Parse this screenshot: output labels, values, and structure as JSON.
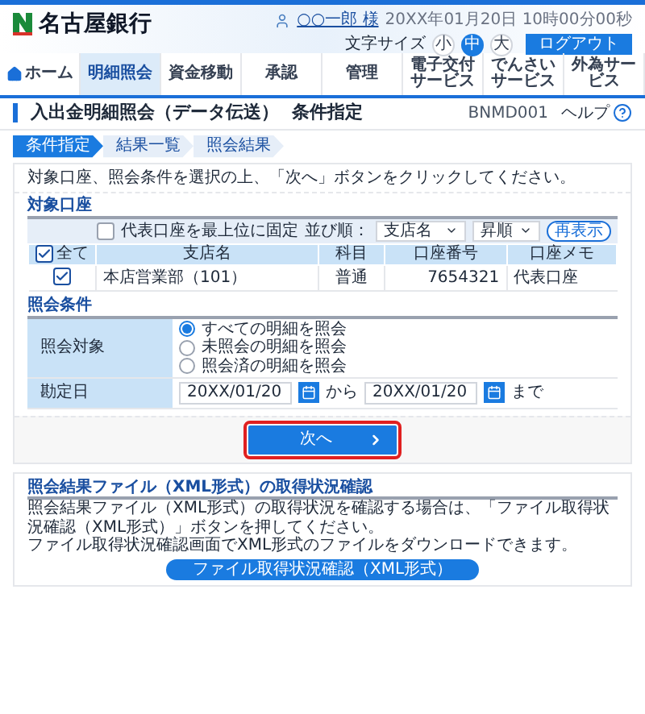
{
  "header": {
    "logo": "名古屋銀行",
    "user": "○○一郎 様",
    "datetime": "20XX年01月20日 10時00分00秒",
    "font_size_label": "文字サイズ",
    "font_sizes": [
      {
        "label": "小",
        "selected": false
      },
      {
        "label": "中",
        "selected": true
      },
      {
        "label": "大",
        "selected": false
      }
    ],
    "logout": "ログアウト"
  },
  "nav": [
    {
      "label": "ホーム",
      "kind": "home",
      "selected": false
    },
    {
      "label": "明細照会",
      "kind": "text",
      "selected": true
    },
    {
      "label": "資金移動",
      "kind": "text",
      "selected": false
    },
    {
      "label": "承認",
      "kind": "text",
      "selected": false
    },
    {
      "label": "管理",
      "kind": "text",
      "selected": false
    },
    {
      "label": "電子交付サービス",
      "kind": "text",
      "selected": false
    },
    {
      "label": "でんさいサービス",
      "kind": "text",
      "selected": false
    },
    {
      "label": "外為サービス",
      "kind": "text",
      "selected": false
    }
  ],
  "page": {
    "title": "入出金明細照会（データ伝送）",
    "subtitle": "条件指定",
    "screen_id": "BNMD001",
    "help": "ヘルプ"
  },
  "steps": [
    {
      "label": "条件指定",
      "selected": true
    },
    {
      "label": "結果一覧",
      "selected": false
    },
    {
      "label": "照会結果",
      "selected": false
    }
  ],
  "instruction": "対象口座、照会条件を選択の上、「次へ」ボタンをクリックしてください。",
  "accounts": {
    "title": "対象口座",
    "pin_option": {
      "label": "代表口座を最上位に固定",
      "checked": false
    },
    "sort_label": "並び順：",
    "sort_field": "支店名",
    "sort_order": "昇順",
    "refresh": "再表示",
    "select_all": {
      "label": "全て",
      "checked": true
    },
    "columns": [
      "支店名",
      "科目",
      "口座番号",
      "口座メモ"
    ],
    "rows": [
      {
        "checked": true,
        "cells": [
          "本店営業部（101）",
          "普通",
          "7654321",
          "代表口座"
        ]
      }
    ]
  },
  "conditions": {
    "title": "照会条件",
    "target": {
      "label": "照会対象",
      "options": [
        {
          "label": "すべての明細を照会",
          "selected": true
        },
        {
          "label": "未照会の明細を照会",
          "selected": false
        },
        {
          "label": "照会済の明細を照会",
          "selected": false
        }
      ]
    },
    "date": {
      "label": "勘定日",
      "from": "20XX/01/20",
      "between": "から",
      "to": "20XX/01/20",
      "after": "まで"
    }
  },
  "next_button": "次へ",
  "xml": {
    "title": "照会結果ファイル（XML形式）の取得状況確認",
    "lines": [
      "照会結果ファイル（XML形式）の取得状況を確認する場合は、「ファイル取得状況確認（XML形式）」ボタンを押してください。",
      "ファイル取得状況確認画面でXML形式のファイルをダウンロードできます。"
    ],
    "button": "ファイル取得状況確認（XML形式）"
  }
}
